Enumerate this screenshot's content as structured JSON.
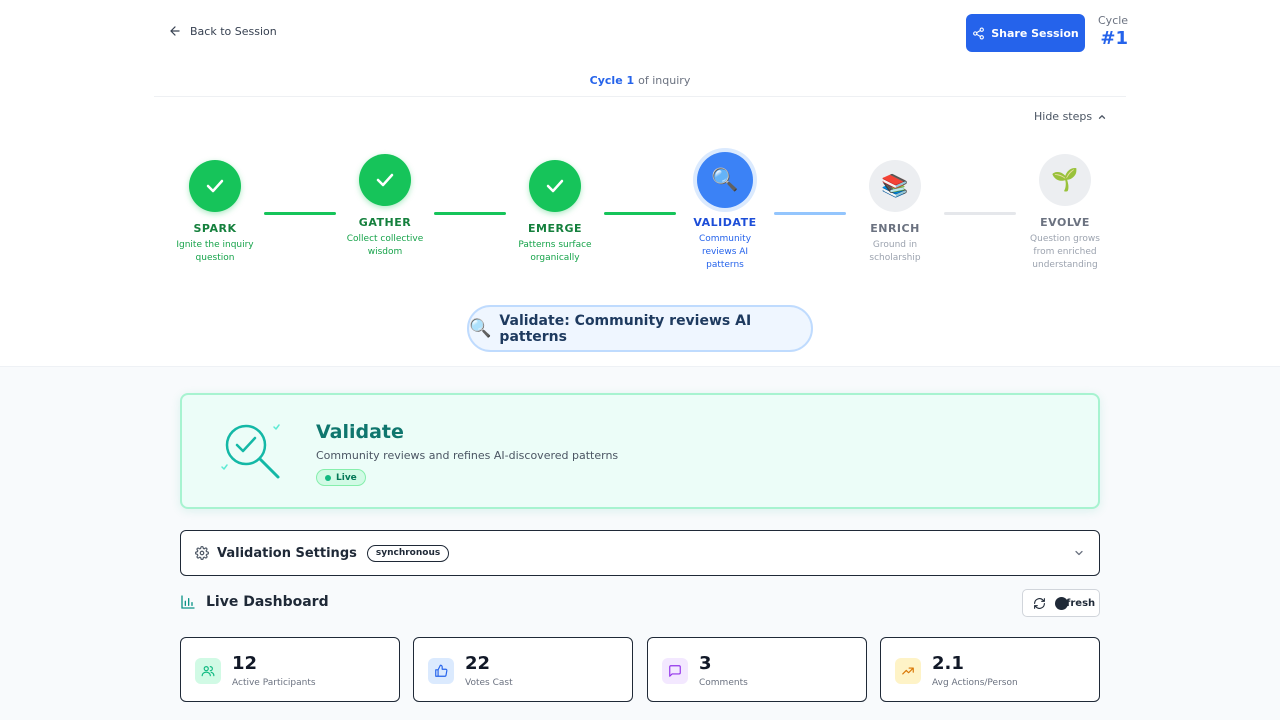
{
  "nav": {
    "back_label": "Back to Session"
  },
  "header": {
    "share_label": "Share Session",
    "cycle_label": "Cycle",
    "cycle_number": "#1",
    "inquiry_cycle": "Cycle 1",
    "inquiry_suffix": "of inquiry",
    "hide_steps_label": "Hide steps"
  },
  "steps": [
    {
      "name": "SPARK",
      "desc": "Ignite the inquiry question",
      "state": "done",
      "icon": "check-icon"
    },
    {
      "name": "GATHER",
      "desc": "Collect collective wisdom",
      "state": "done",
      "icon": "check-icon"
    },
    {
      "name": "EMERGE",
      "desc": "Patterns surface organically",
      "state": "done",
      "icon": "check-icon"
    },
    {
      "name": "VALIDATE",
      "desc": "Community reviews AI patterns",
      "state": "active",
      "icon": "🔍"
    },
    {
      "name": "ENRICH",
      "desc": "Ground in scholarship",
      "state": "pending",
      "icon": "📚"
    },
    {
      "name": "EVOLVE",
      "desc": "Question grows from enriched understanding",
      "state": "pending",
      "icon": "🌱"
    }
  ],
  "current_stage": {
    "icon": "🔍",
    "label": "Validate: Community reviews AI patterns"
  },
  "stage_card": {
    "title": "Validate",
    "subtitle": "Community reviews and refines AI-discovered patterns",
    "status": "Live"
  },
  "settings": {
    "label": "Validation Settings",
    "mode": "synchronous"
  },
  "dashboard": {
    "title": "Live Dashboard",
    "refresh_label": "fresh",
    "stats": [
      {
        "value": "12",
        "label": "Active Participants",
        "icon": "users-icon",
        "color": "#10b981",
        "bg": "#d1fae5"
      },
      {
        "value": "22",
        "label": "Votes Cast",
        "icon": "thumbs-up-icon",
        "color": "#2563eb",
        "bg": "#dbeafe"
      },
      {
        "value": "3",
        "label": "Comments",
        "icon": "comment-icon",
        "color": "#9333ea",
        "bg": "#f3e8ff"
      },
      {
        "value": "2.1",
        "label": "Avg Actions/Person",
        "icon": "trending-up-icon",
        "color": "#d97706",
        "bg": "#fef3c7"
      }
    ]
  },
  "colors": {
    "primary": "#2563eb",
    "success": "#16c45a",
    "teal": "#0f766e"
  }
}
